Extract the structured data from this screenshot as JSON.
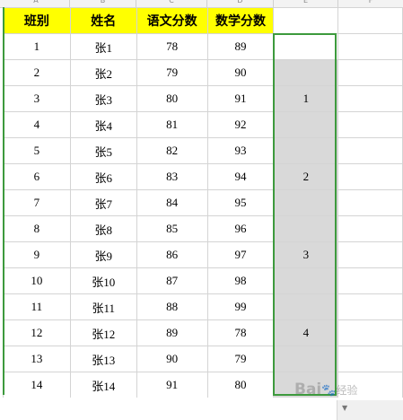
{
  "columns": [
    "A",
    "B",
    "C",
    "D",
    "E",
    "F"
  ],
  "headers": [
    "班别",
    "姓名",
    "语文分数",
    "数学分数"
  ],
  "rows": [
    [
      "1",
      "张1",
      "78",
      "89",
      ""
    ],
    [
      "2",
      "张2",
      "79",
      "90",
      ""
    ],
    [
      "3",
      "张3",
      "80",
      "91",
      "1"
    ],
    [
      "4",
      "张4",
      "81",
      "92",
      ""
    ],
    [
      "5",
      "张5",
      "82",
      "93",
      ""
    ],
    [
      "6",
      "张6",
      "83",
      "94",
      "2"
    ],
    [
      "7",
      "张7",
      "84",
      "95",
      ""
    ],
    [
      "8",
      "张8",
      "85",
      "96",
      ""
    ],
    [
      "9",
      "张9",
      "86",
      "97",
      "3"
    ],
    [
      "10",
      "张10",
      "87",
      "98",
      ""
    ],
    [
      "11",
      "张11",
      "88",
      "99",
      ""
    ],
    [
      "12",
      "张12",
      "89",
      "78",
      "4"
    ],
    [
      "13",
      "张13",
      "90",
      "79",
      ""
    ],
    [
      "14",
      "张14",
      "91",
      "80",
      ""
    ]
  ],
  "watermark": {
    "brand": "Bai",
    "suffix": "经验"
  },
  "colors": {
    "header_fill": "#ffff00",
    "selection_border": "#3d9a3d",
    "selection_fill": "#d9d9d9"
  }
}
